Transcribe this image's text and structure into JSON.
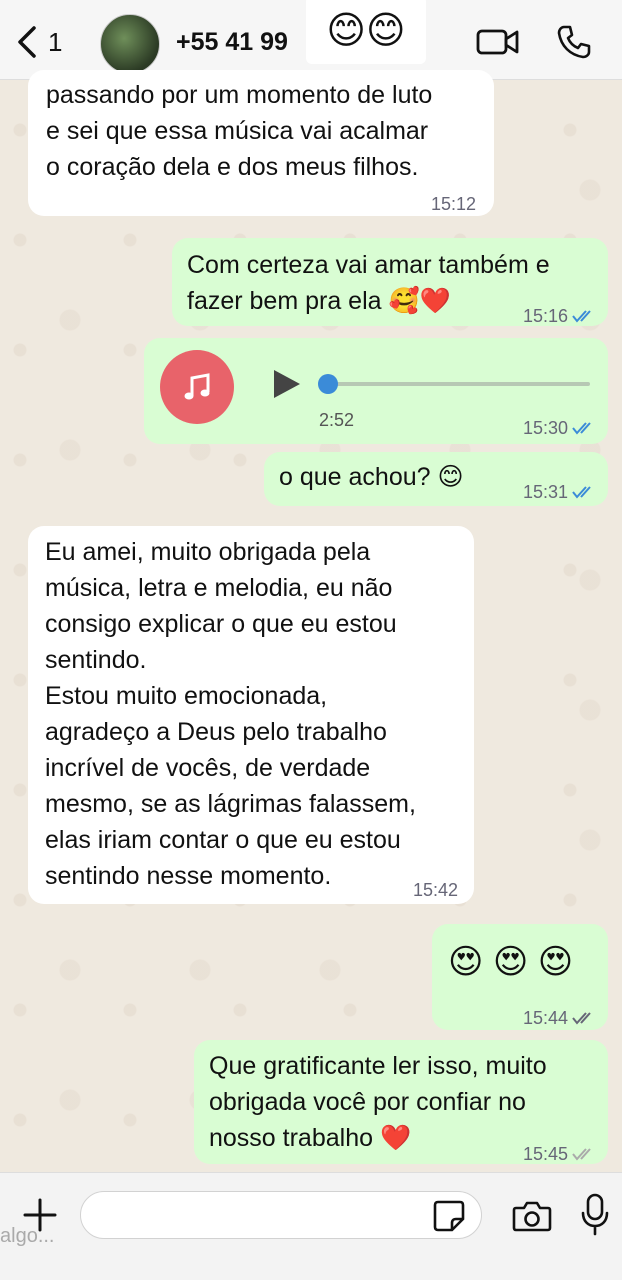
{
  "header": {
    "back_count": "1",
    "contact_name": "+55 41 99",
    "sticker": "😊😊"
  },
  "messages": [
    {
      "text": "passando por um momento de luto\ne sei que essa música vai acalmar\no coração dela e dos meus filhos.",
      "time": "15:12"
    },
    {
      "text": "Com certeza vai amar também e\nfazer bem pra ela 🥰❤️",
      "time": "15:16"
    },
    {
      "audio_duration": "2:52",
      "time": "15:30",
      "audio_progress": 0.0
    },
    {
      "text": "o que achou? 😊",
      "time": "15:31"
    },
    {
      "text": "Eu amei, muito obrigada pela\nmúsica, letra e melodia, eu não\nconsigo explicar o que eu estou\nsentindo.\nEstou muito emocionada,\nagradeço a Deus pelo trabalho\nincrível de vocês, de verdade\nmesmo, se as lágrimas falassem,\nelas iriam contar o que eu estou\nsentindo nesse momento.",
      "time": "15:42"
    },
    {
      "text": "😍 😍 😍",
      "time": "15:44"
    },
    {
      "text": "Que gratificante ler isso, muito\nobrigada você por confiar no\nnosso trabalho ❤️",
      "time": "15:45"
    }
  ],
  "footer": {
    "placeholder": "algo..."
  },
  "colors": {
    "outgoing_bubble": "#d9fdd3",
    "incoming_bubble": "#ffffff",
    "read_ticks": "#3b8bd8",
    "audio_icon_bg": "#e8636a"
  }
}
